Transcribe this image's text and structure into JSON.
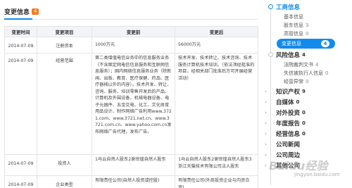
{
  "section": {
    "title": "变更信息",
    "count": "4"
  },
  "table": {
    "headers": [
      "变更时间",
      "变更项目",
      "变更前",
      "变更后"
    ],
    "rows": [
      {
        "date": "2014-07-09",
        "item": "注册资本",
        "before": "1000万元",
        "after": "56000万元"
      },
      {
        "date": "2014-07-09",
        "item": "经营范围",
        "before": "第二类增值电信业务中的信息服务业务（不含固定网电信信息服务和互联网信息服务）；国内网络信息服务业务（除新闻、出版、教育、医疗保健、药品、医疗器械以外的内容）。技术开发、转让、咨询、服务、培训零售开发后的产品、计算机及外围设备、机械电器设备、电子元器件、五金交电、化工、文化体育用品设计、制作网络广告利用www.3721.com、www.3721.net.cn、www.3721.com.cn、www.yahoo.com.cn发布网络广告代理，发布广告。",
        "after": "技术开发、技术转让、技术咨询、技术服务计算机技术培训。（依法须经批准的项目，经相关部门批准后方可开展经营活动）"
      },
      {
        "date": "2014-07-09",
        "item": "投资人",
        "before": "1马云自然人股东2谢世煌自然人股东",
        "after": "1马云自然人股东2谢世煌自然人股东3浙江天猫技术有限公司法人股东"
      },
      {
        "date": "2014-07-09",
        "item": "企业类型",
        "before": "有限责任公司(自然人投资或控股)",
        "after": "有限责任公司(外商投资企业与内资合资)"
      }
    ]
  },
  "sidenav": {
    "sections": [
      {
        "label": "工商信息",
        "active": true,
        "children": [
          {
            "label": "基本信息",
            "count": ""
          },
          {
            "label": "股东信息",
            "count": "3"
          },
          {
            "label": "高管信息",
            "count": "0"
          },
          {
            "label": "变更信息",
            "count": "4"
          }
        ]
      },
      {
        "label": "风险信息",
        "count": "4",
        "children": [
          {
            "label": "法院裁判文书",
            "count": "4"
          },
          {
            "label": "失信被执行人信息",
            "count": "0"
          },
          {
            "label": "经营异常",
            "count": "0"
          }
        ]
      },
      {
        "label": "知识产权",
        "count": "9"
      },
      {
        "label": "自媒体",
        "count": "0"
      },
      {
        "label": "对外投资",
        "count": "0"
      },
      {
        "label": "年度报告",
        "count": "0"
      },
      {
        "label": "经营信息",
        "count": "0"
      },
      {
        "label": "公司新闻",
        "count": ""
      },
      {
        "label": "公司周边",
        "count": ""
      },
      {
        "label": "其他公司",
        "count": ""
      }
    ]
  },
  "watermark": {
    "text": "Baidu经验",
    "domain": "jingyan.baidu.com"
  },
  "colors": {
    "accent": "#128bed",
    "badge": "#f37b1d"
  }
}
